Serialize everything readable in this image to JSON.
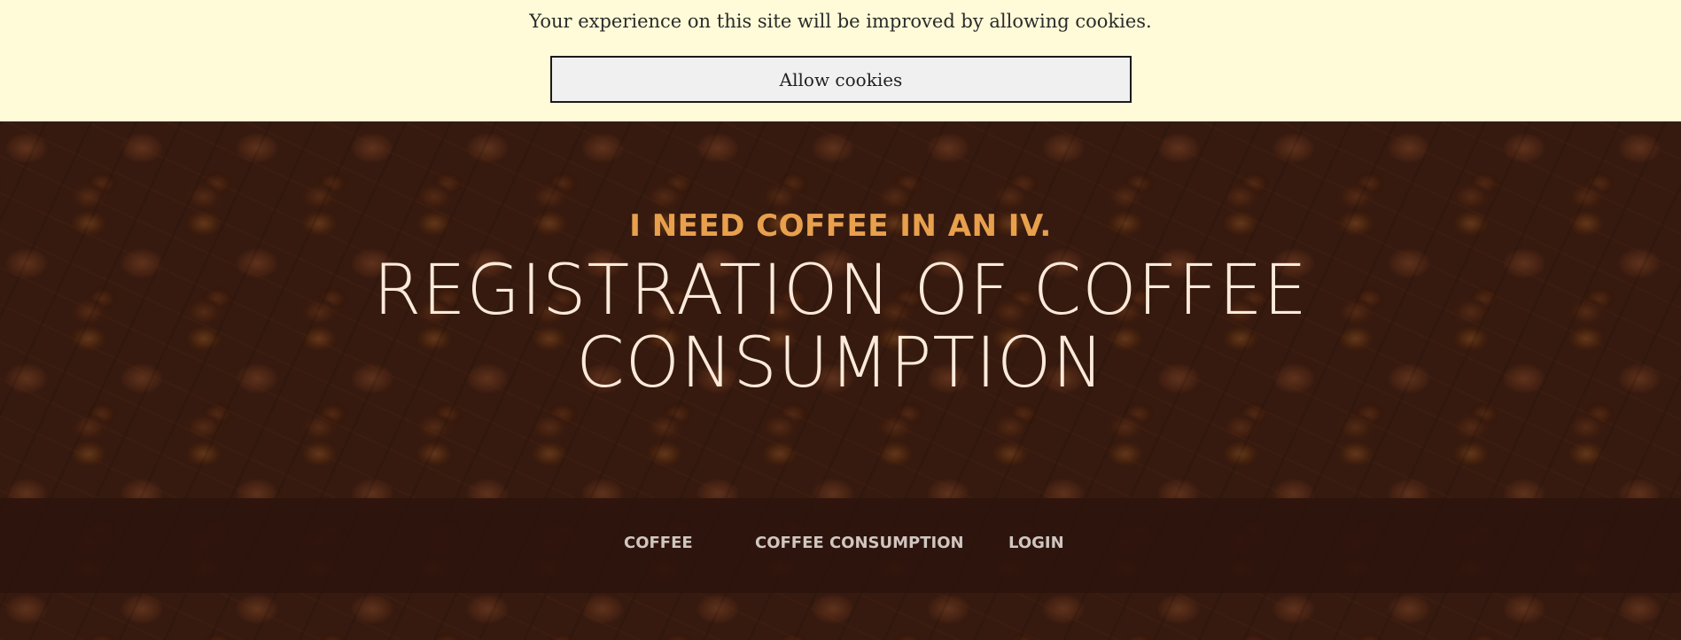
{
  "cookie_banner": {
    "message": "Your experience on this site will be improved by allowing cookies.",
    "allow_label": "Allow cookies"
  },
  "hero": {
    "tagline": "I NEED COFFEE IN AN IV.",
    "headline_line1": "REGISTRATION OF COFFEE",
    "headline_line2": "CONSUMPTION"
  },
  "nav": {
    "items": [
      {
        "label": "COFFEE"
      },
      {
        "label": "COFFEE CONSUMPTION"
      },
      {
        "label": "LOGIN"
      }
    ]
  },
  "colors": {
    "cookie_bg": "#fffbd8",
    "tagline": "#e8a04d",
    "headline": "#fbeada",
    "nav_bg": "#2d140c",
    "nav_text": "#cfc6c0"
  },
  "background_image": "coffee-beans"
}
